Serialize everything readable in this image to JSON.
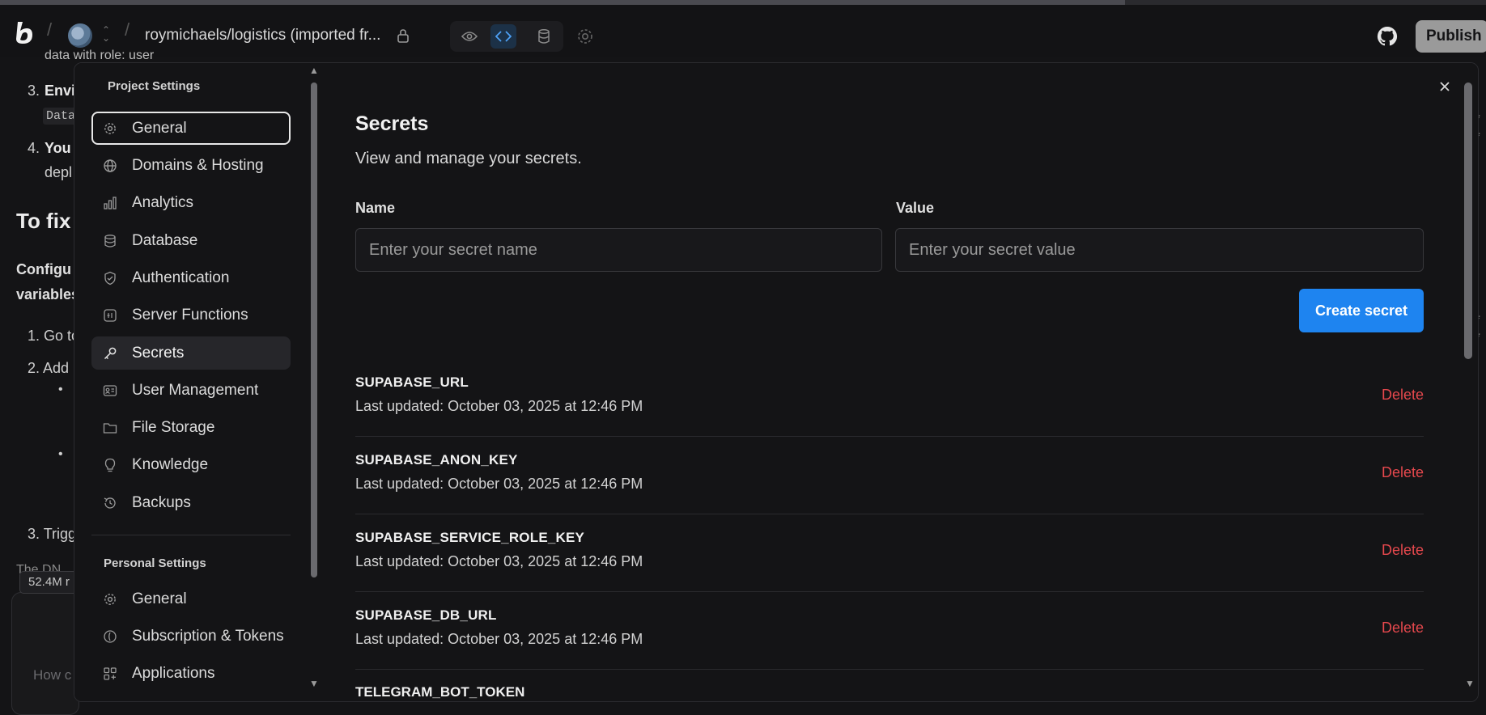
{
  "header": {
    "project_name": "roymichaels/logistics (imported fr...",
    "publish_label": "Publish"
  },
  "background_chat": {
    "lines": [
      "data with role: user",
      "3.",
      "Envi",
      "Data",
      "4.",
      "You",
      "depl",
      "To fix",
      "Configu",
      "variables",
      "1. Go to",
      "2. Add",
      "3. Trigg",
      "52.4M r",
      "How c",
      "The DN"
    ]
  },
  "settings": {
    "project_section_title": "Project Settings",
    "project_items": [
      {
        "label": "General",
        "icon": "gear-icon"
      },
      {
        "label": "Domains & Hosting",
        "icon": "globe-icon"
      },
      {
        "label": "Analytics",
        "icon": "bar-chart-icon"
      },
      {
        "label": "Database",
        "icon": "database-icon"
      },
      {
        "label": "Authentication",
        "icon": "shield-icon"
      },
      {
        "label": "Server Functions",
        "icon": "function-icon"
      },
      {
        "label": "Secrets",
        "icon": "key-icon"
      },
      {
        "label": "User Management",
        "icon": "id-card-icon"
      },
      {
        "label": "File Storage",
        "icon": "folder-icon"
      },
      {
        "label": "Knowledge",
        "icon": "lightbulb-icon"
      },
      {
        "label": "Backups",
        "icon": "history-icon"
      }
    ],
    "personal_section_title": "Personal Settings",
    "personal_items": [
      {
        "label": "General",
        "icon": "gear-icon"
      },
      {
        "label": "Subscription & Tokens",
        "icon": "coin-icon"
      },
      {
        "label": "Applications",
        "icon": "apps-icon"
      }
    ]
  },
  "secrets": {
    "title": "Secrets",
    "subtitle": "View and manage your secrets.",
    "name_label": "Name",
    "value_label": "Value",
    "name_placeholder": "Enter your secret name",
    "value_placeholder": "Enter your secret value",
    "create_label": "Create secret",
    "delete_label": "Delete",
    "items": [
      {
        "name": "SUPABASE_URL",
        "updated": "Last updated: October 03, 2025 at 12:46 PM"
      },
      {
        "name": "SUPABASE_ANON_KEY",
        "updated": "Last updated: October 03, 2025 at 12:46 PM"
      },
      {
        "name": "SUPABASE_SERVICE_ROLE_KEY",
        "updated": "Last updated: October 03, 2025 at 12:46 PM"
      },
      {
        "name": "SUPABASE_DB_URL",
        "updated": "Last updated: October 03, 2025 at 12:46 PM"
      }
    ],
    "partial_item_name": "TELEGRAM_BOT_TOKEN"
  },
  "colors": {
    "accent": "#1e84f0",
    "danger": "#e5484d",
    "background": "#141416"
  }
}
